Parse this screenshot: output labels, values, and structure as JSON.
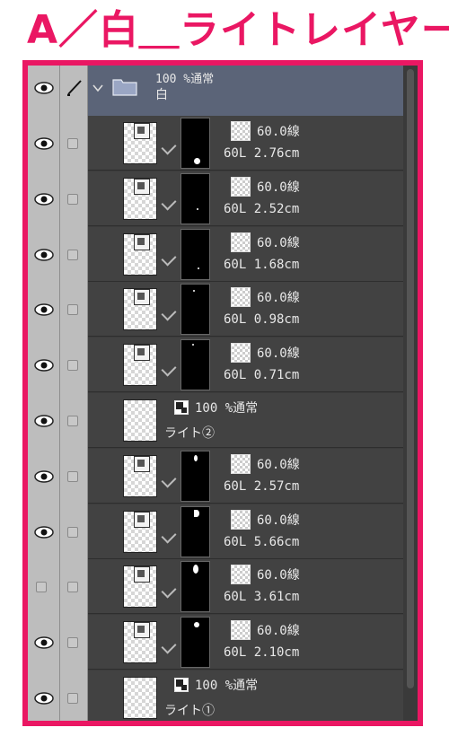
{
  "title": "A／白＿ライトレイヤー",
  "folder": {
    "opacity_mode": "100 %通常",
    "name": "白"
  },
  "layers": [
    {
      "type": "effect",
      "visible": true,
      "mask_spot": "bottom-big",
      "opacity_mode": "60.0線",
      "info": "60L 2.76cm"
    },
    {
      "type": "effect",
      "visible": true,
      "mask_spot": "tiny",
      "opacity_mode": "60.0線",
      "info": "60L 2.52cm"
    },
    {
      "type": "effect",
      "visible": true,
      "mask_spot": "tiny2",
      "opacity_mode": "60.0線",
      "info": "60L 1.68cm"
    },
    {
      "type": "effect",
      "visible": true,
      "mask_spot": "top-tiny",
      "opacity_mode": "60.0線",
      "info": "60L 0.98cm"
    },
    {
      "type": "effect",
      "visible": true,
      "mask_spot": "top-tiny2",
      "opacity_mode": "60.0線",
      "info": "60L 0.71cm"
    },
    {
      "type": "raster",
      "visible": true,
      "opacity_mode": "100 %通常",
      "info": "ライト②"
    },
    {
      "type": "effect",
      "visible": true,
      "mask_spot": "top-med",
      "opacity_mode": "60.0線",
      "info": "60L 2.57cm"
    },
    {
      "type": "effect",
      "visible": true,
      "mask_spot": "top-curve",
      "opacity_mode": "60.0線",
      "info": "60L 5.66cm"
    },
    {
      "type": "effect",
      "visible": false,
      "mask_spot": "top-big",
      "opacity_mode": "60.0線",
      "info": "60L 3.61cm"
    },
    {
      "type": "effect",
      "visible": true,
      "mask_spot": "mid",
      "opacity_mode": "60.0線",
      "info": "60L 2.10cm"
    },
    {
      "type": "raster",
      "visible": true,
      "opacity_mode": "100 %通常",
      "info": "ライト①"
    }
  ]
}
